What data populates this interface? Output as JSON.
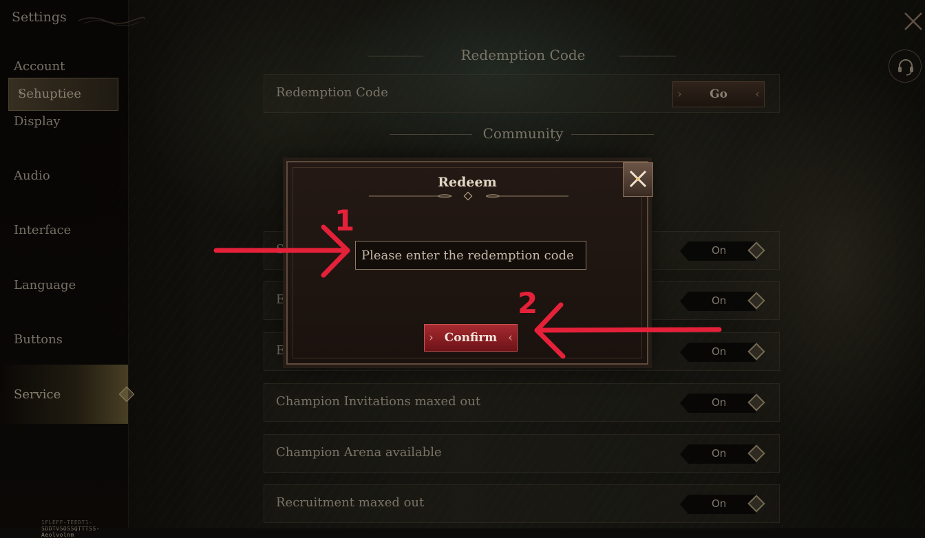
{
  "sidebar": {
    "title": "Settings",
    "items": [
      {
        "label": "Account"
      },
      {
        "label": "Sehuptiee"
      },
      {
        "label": "Display"
      },
      {
        "label": "Audio"
      },
      {
        "label": "Interface"
      },
      {
        "label": "Language"
      },
      {
        "label": "Buttons"
      },
      {
        "label": "Service"
      }
    ],
    "selected_chevron": "‹",
    "version_text": "1FLEFF-TEEDT1-SDDTVSOSSQTTTSS- Aeolvolnm"
  },
  "sections": {
    "redemption_header": "Redemption Code",
    "community_header": "Community"
  },
  "redemption_row": {
    "label": "Redemption Code",
    "go_label": "Go"
  },
  "rows": [
    {
      "label": "S",
      "toggle": "On"
    },
    {
      "label": "E",
      "toggle": "On"
    },
    {
      "label": "E",
      "toggle": "On"
    },
    {
      "label": "Champion Invitations maxed out",
      "toggle": "On"
    },
    {
      "label": "Champion Arena available",
      "toggle": "On"
    },
    {
      "label": "Recruitment maxed out",
      "toggle": "On"
    }
  ],
  "modal": {
    "title": "Redeem",
    "input_placeholder": "Please enter the redemption code",
    "input_value": "",
    "confirm_label": "Confirm"
  },
  "annotations": {
    "step1": "1",
    "step2": "2",
    "color": "#e5213a"
  },
  "icons": {
    "close": "close-icon",
    "headset": "headset-icon",
    "modal_close": "close-icon"
  },
  "colors": {
    "accent_red": "#a52a2f",
    "text_light": "#c3b9a5"
  }
}
